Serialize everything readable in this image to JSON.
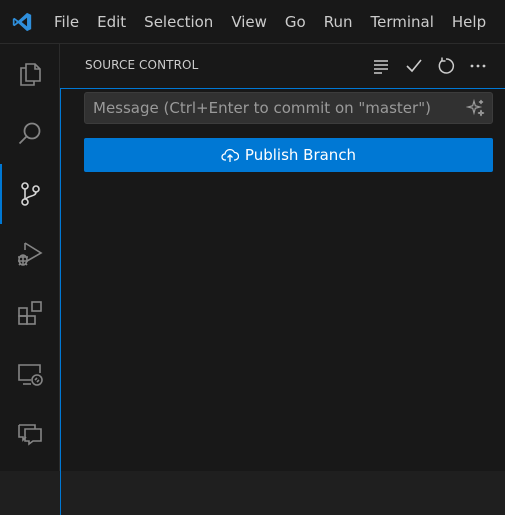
{
  "menubar": {
    "logo_icon": "vscode-logo-icon",
    "items": [
      "File",
      "Edit",
      "Selection",
      "View",
      "Go",
      "Run",
      "Terminal",
      "Help"
    ]
  },
  "activity_bar": {
    "items": [
      {
        "name": "explorer",
        "icon": "files-icon",
        "active": false
      },
      {
        "name": "search",
        "icon": "search-icon",
        "active": false
      },
      {
        "name": "source-control",
        "icon": "source-control-icon",
        "active": true
      },
      {
        "name": "run-and-debug",
        "icon": "run-debug-icon",
        "active": false
      },
      {
        "name": "extensions",
        "icon": "extensions-icon",
        "active": false
      },
      {
        "name": "remote-explorer",
        "icon": "remote-explorer-icon",
        "active": false
      },
      {
        "name": "chat",
        "icon": "chat-icon",
        "active": false
      }
    ]
  },
  "sidebar": {
    "title": "SOURCE CONTROL",
    "actions": [
      "view-as-tree-icon",
      "commit-check-icon",
      "refresh-icon",
      "more-actions-icon"
    ],
    "commit_input": {
      "placeholder": "Message (Ctrl+Enter to commit on \"master\")",
      "value": "",
      "icon": "sparkle-icon"
    },
    "publish_button": {
      "label": "Publish Branch",
      "icon": "cloud-upload-icon"
    }
  },
  "colors": {
    "accent": "#0078d4",
    "background": "#181818",
    "foreground": "#cccccc"
  }
}
